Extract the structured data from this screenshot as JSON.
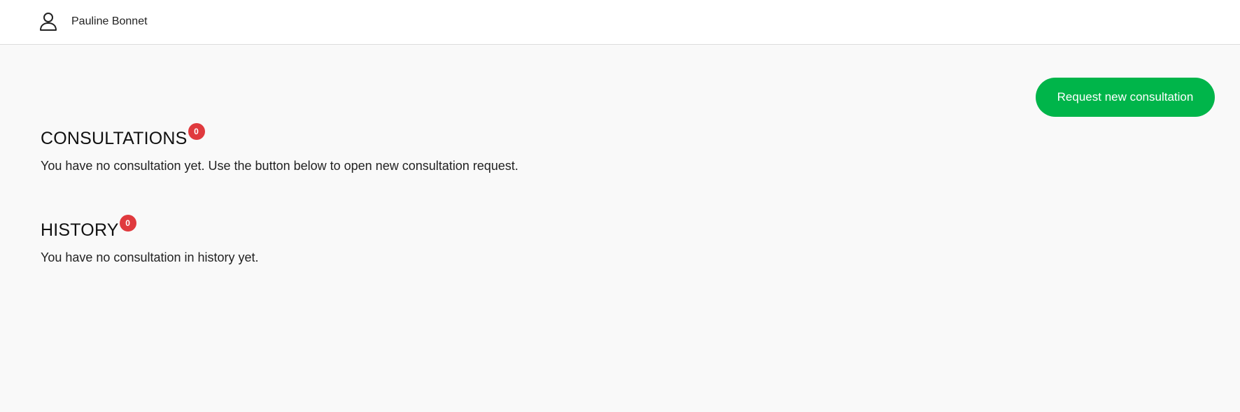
{
  "header": {
    "user_icon": "user-icon",
    "user_name": "Pauline Bonnet"
  },
  "actions": {
    "request_button_label": "Request new consultation",
    "request_button_color": "#00b54a"
  },
  "consultations": {
    "title": "CONSULTATIONS",
    "count": "0",
    "empty_message": "You have no consultation yet. Use the button below to open new consultation request."
  },
  "history": {
    "title": "HISTORY",
    "count": "0",
    "empty_message": "You have no consultation in history yet."
  },
  "colors": {
    "badge": "#e03a3e",
    "background": "#f9f9f9",
    "header_background": "#ffffff"
  }
}
